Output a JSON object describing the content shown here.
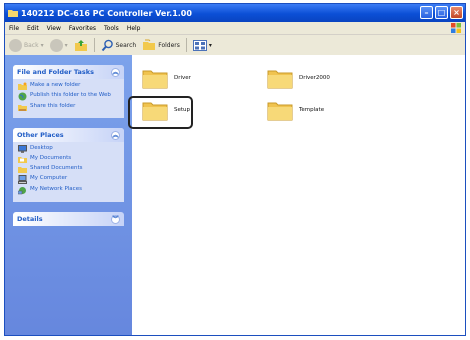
{
  "window": {
    "title": "140212 DC-616 PC Controller Ver.1.00"
  },
  "menu": [
    "File",
    "Edit",
    "View",
    "Favorites",
    "Tools",
    "Help"
  ],
  "toolbar": {
    "back_label": "Back",
    "search_label": "Search",
    "folders_label": "Folders"
  },
  "sidebar": {
    "file_tasks": {
      "title": "File and Folder Tasks",
      "items": [
        "Make a new folder",
        "Publish this folder to the Web",
        "Share this folder"
      ]
    },
    "other_places": {
      "title": "Other Places",
      "items": [
        "Desktop",
        "My Documents",
        "Shared Documents",
        "My Computer",
        "My Network Places"
      ]
    },
    "details": {
      "title": "Details"
    }
  },
  "folders": [
    {
      "name": "Driver"
    },
    {
      "name": "Driver2000"
    },
    {
      "name": "Setup",
      "selected": true
    },
    {
      "name": "Template"
    }
  ]
}
